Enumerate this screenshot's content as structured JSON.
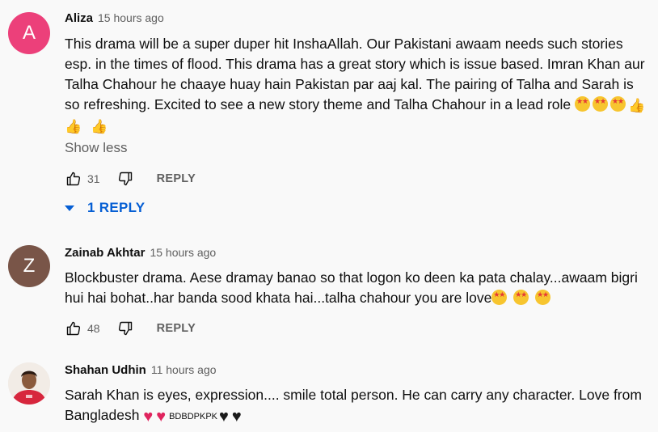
{
  "comments": [
    {
      "author": "Aliza",
      "time": "15 hours ago",
      "avatar_letter": "A",
      "text": "This drama will be a super duper hit InshaAllah. Our Pakistani awaam needs such stories esp. in the times of flood. This drama has a great story which is issue based. Imran Khan aur Talha Chahour he chaaye huay hain Pakistan par aaj kal. The pairing of Talha and Sarah is so refreshing. Excited to see a new story theme and Talha Chahour in a lead role",
      "show_less": "Show less",
      "likes": "31",
      "reply_label": "REPLY",
      "replies_label": "1 REPLY"
    },
    {
      "author": "Zainab Akhtar",
      "time": "15 hours ago",
      "avatar_letter": "Z",
      "text": "Blockbuster drama. Aese dramay banao so that logon ko deen ka pata chalay...awaam bigri hui hai bohat..har banda sood khata hai...talha chahour you are love",
      "likes": "48",
      "reply_label": "REPLY"
    },
    {
      "author": "Shahan Udhin",
      "time": "11 hours ago",
      "text": "Sarah Khan is eyes, expression.... smile  total person. He can carry any character. Love from Bangladesh",
      "flags_text": "BDBDPKPK"
    }
  ],
  "icons": {
    "like": "thumbs-up-icon",
    "dislike": "thumbs-down-icon",
    "caret": "caret-down-icon",
    "emoji_star_eyes": "star-struck-emoji",
    "emoji_thumb": "thumbs-up-emoji",
    "emoji_red_heart": "red-heart-emoji",
    "emoji_black_heart": "black-heart-emoji"
  },
  "colors": {
    "background": "#f9f9f9",
    "link_blue": "#065fd4",
    "avatar_a": "#ec407a",
    "avatar_z": "#795548",
    "secondary_text": "#606060"
  }
}
